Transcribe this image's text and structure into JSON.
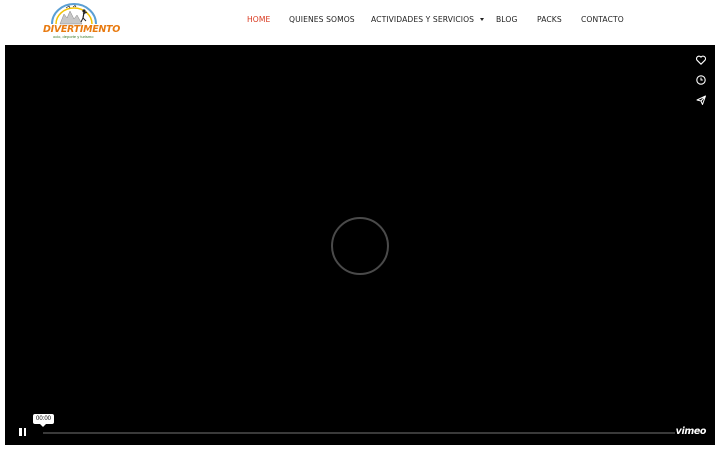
{
  "logo": {
    "name": "DIVERTIMENTO",
    "tagline": "ocio, deporte y turismo"
  },
  "nav": {
    "items": [
      {
        "label": "HOME",
        "active": true
      },
      {
        "label": "QUIENES SOMOS",
        "active": false
      },
      {
        "label": "ACTIVIDADES Y SERVICIOS",
        "active": false,
        "has_dropdown": true
      },
      {
        "label": "BLOG",
        "active": false
      },
      {
        "label": "PACKS",
        "active": false
      },
      {
        "label": "CONTACTO",
        "active": false
      }
    ]
  },
  "player": {
    "side_icons": [
      "heart-icon",
      "clock-icon",
      "paper-plane-icon"
    ],
    "state": "playing",
    "time": "00:00",
    "progress_fraction": 0,
    "brand": "vimeo"
  },
  "colors": {
    "nav_active": "#d9381e",
    "nav_text": "#222222",
    "player_bg": "#000000",
    "logo_orange": "#e87a10"
  }
}
